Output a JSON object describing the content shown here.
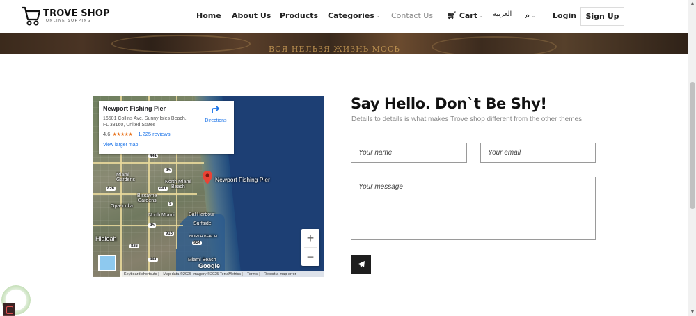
{
  "brand": {
    "name": "TROVE SHOP",
    "tagline": "ONLINE SOPPING"
  },
  "nav": {
    "home": "Home",
    "about": "About Us",
    "products": "Products",
    "categories": "Categories",
    "contact": "Contact Us",
    "cart": "Cart",
    "language": "العربية",
    "login": "Login",
    "signup": "Sign Up"
  },
  "banner": {
    "text": "ВСЯ НЕЛЬЗЯ ЖИЗНЬ МОСЬ"
  },
  "map": {
    "place_name": "Newport Fishing Pier",
    "address": "16501 Collins Ave, Sunny Isles Beach, FL 33160, United States",
    "rating": "4.6",
    "stars": "★★★★★",
    "reviews": "1,225 reviews",
    "larger_map": "View larger map",
    "directions": "Directions",
    "pin_label": "Newport Fishing Pier",
    "zoom_in": "+",
    "zoom_out": "−",
    "google": "Google",
    "footer": {
      "shortcuts": "Keyboard shortcuts",
      "attribution": "Map data ©2025 Imagery ©2025 TerraMetrics",
      "terms": "Terms",
      "report": "Report a map error"
    },
    "cities": {
      "miami_gardens": "Miami\nGardens",
      "north_miami_beach": "North Miami\nBeach",
      "biscayne_gardens": "Biscayne\nGardens",
      "opa_locka": "Opa-locka",
      "north_miami": "North Miami",
      "bal_harbour": "Bal Harbour",
      "surfside": "Surfside",
      "north_beach": "NORTH BEACH",
      "hialeah": "Hialeah",
      "miami_beach": "Miami Beach"
    },
    "highways": [
      "441",
      "95",
      "826",
      "441",
      "9",
      "934",
      "441",
      "95",
      "916",
      "826"
    ]
  },
  "contact": {
    "title": "Say Hello. Don`t Be Shy!",
    "subtitle": "Details to details is what makes Trove shop different from the other themes.",
    "name_placeholder": "Your name",
    "email_placeholder": "Your email",
    "message_placeholder": "Your message"
  },
  "colors": {
    "accent": "#1e1e1e",
    "link": "#1a73e8",
    "pin": "#ea4335"
  }
}
